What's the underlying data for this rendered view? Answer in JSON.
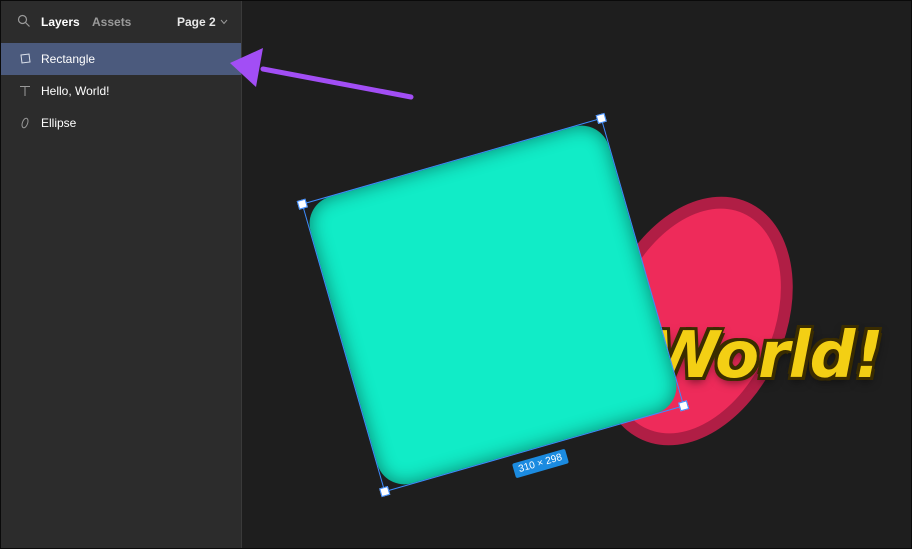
{
  "sidebar": {
    "tabs": [
      {
        "label": "Layers"
      },
      {
        "label": "Assets"
      }
    ],
    "page_selector": {
      "value": "Page 2"
    },
    "layers": [
      {
        "label": "Rectangle",
        "icon": "rectangle-icon"
      },
      {
        "label": "Hello, World!",
        "icon": "text-icon"
      },
      {
        "label": "Ellipse",
        "icon": "ellipse-icon"
      }
    ]
  },
  "canvas": {
    "text_layer": "World!",
    "dimension_badge": "310 × 298"
  },
  "colors": {
    "rectangle_fill": "#11ecc7",
    "ellipse_fill": "#ee2b5a",
    "text_fill": "#f3cf14",
    "selection": "#3d8cff",
    "annotation_arrow": "#a24ef5"
  }
}
